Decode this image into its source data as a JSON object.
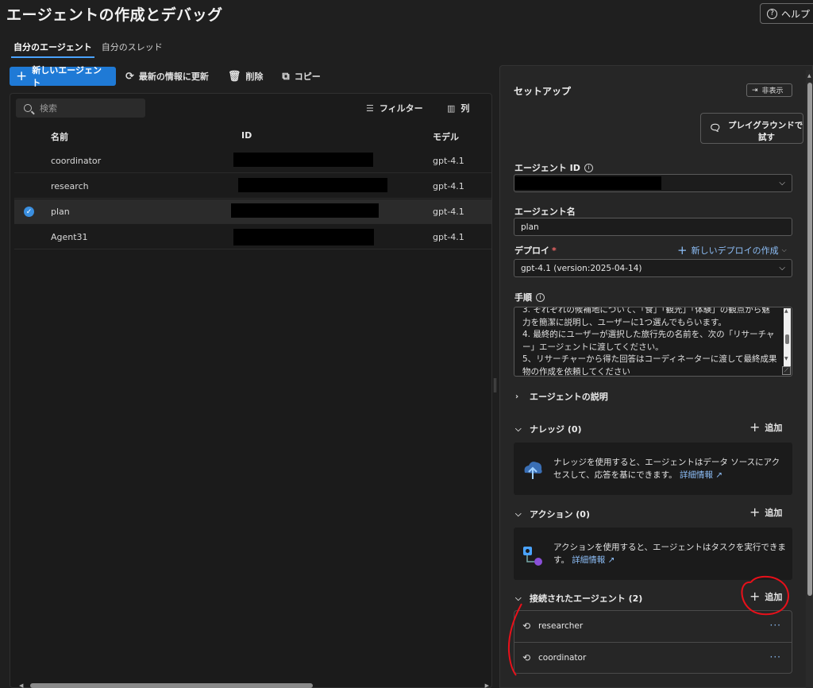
{
  "page": {
    "title": "エージェントの作成とデバッグ",
    "help_label": "ヘルプ"
  },
  "tabs": [
    {
      "label": "自分のエージェント",
      "active": true
    },
    {
      "label": "自分のスレッド",
      "active": false
    }
  ],
  "toolbar": {
    "new_agent": "新しいエージェント",
    "refresh": "最新の情報に更新",
    "delete": "削除",
    "copy": "コピー"
  },
  "list": {
    "search_placeholder": "検索",
    "filter_label": "フィルター",
    "columns_label": "列",
    "headers": {
      "name": "名前",
      "id": "ID",
      "model": "モデル"
    },
    "rows": [
      {
        "name": "coordinator",
        "id_redacted": true,
        "model": "gpt-4.1",
        "selected": false
      },
      {
        "name": "research",
        "id_redacted": true,
        "model": "gpt-4.1",
        "selected": false
      },
      {
        "name": "plan",
        "id_redacted": true,
        "model": "gpt-4.1",
        "selected": true
      },
      {
        "name": "Agent31",
        "id_redacted": true,
        "model": "gpt-4.1",
        "selected": false
      }
    ]
  },
  "setup": {
    "title": "セットアップ",
    "hide_label": "非表示",
    "playground_line1": "プレイグラウンドで",
    "playground_line2": "試す",
    "agent_id_label": "エージェント ID",
    "agent_name_label": "エージェント名",
    "agent_name_value": "plan",
    "deploy_label": "デプロイ",
    "new_deploy_label": "新しいデプロイの作成",
    "deploy_value": "gpt-4.1 (version:2025-04-14)",
    "instructions_label": "手順",
    "instructions_lines": [
      "3. それぞれの候補地について、「食」「観光」「体験」の観点から魅",
      "力を簡潔に説明し、ユーザーに1つ選んでもらいます。",
      "4. 最終的にユーザーが選択した旅行先の名前を、次の「リサーチャ",
      "ー」エージェントに渡してください。",
      "5、リサーチャーから得た回答はコーディネーターに渡して最終成果",
      "物の作成を依頼してください"
    ],
    "agent_description_label": "エージェントの説明",
    "add_label": "追加",
    "knowledge_label": "ナレッジ (0)",
    "knowledge_text": "ナレッジを使用すると、エージェントはデータ ソースにアクセスして、応答を基にできます。",
    "knowledge_link": "詳細情報",
    "actions_label": "アクション (0)",
    "actions_text": "アクションを使用すると、エージェントはタスクを実行できます。",
    "actions_link": "詳細情報",
    "connected_label": "接続されたエージェント (2)",
    "connected_agents": [
      {
        "name": "researcher",
        "more": "···"
      },
      {
        "name": "coordinator",
        "more": "···"
      }
    ]
  },
  "colors": {
    "accent": "#1f7ad6",
    "link": "#8dbef7",
    "annotation": "#e8101a",
    "required": "#e66666"
  },
  "icons": [
    "plus-icon",
    "refresh-icon",
    "trash-icon",
    "copy-icon",
    "search-icon",
    "filter-icon",
    "columns-icon",
    "checkmark-icon",
    "chevron-down-icon",
    "chevron-right-icon",
    "info-icon",
    "chat-icon",
    "hide-panel-icon",
    "external-link-icon",
    "agent-icon",
    "more-icon",
    "cloud-upload-icon",
    "action-flow-icon"
  ]
}
